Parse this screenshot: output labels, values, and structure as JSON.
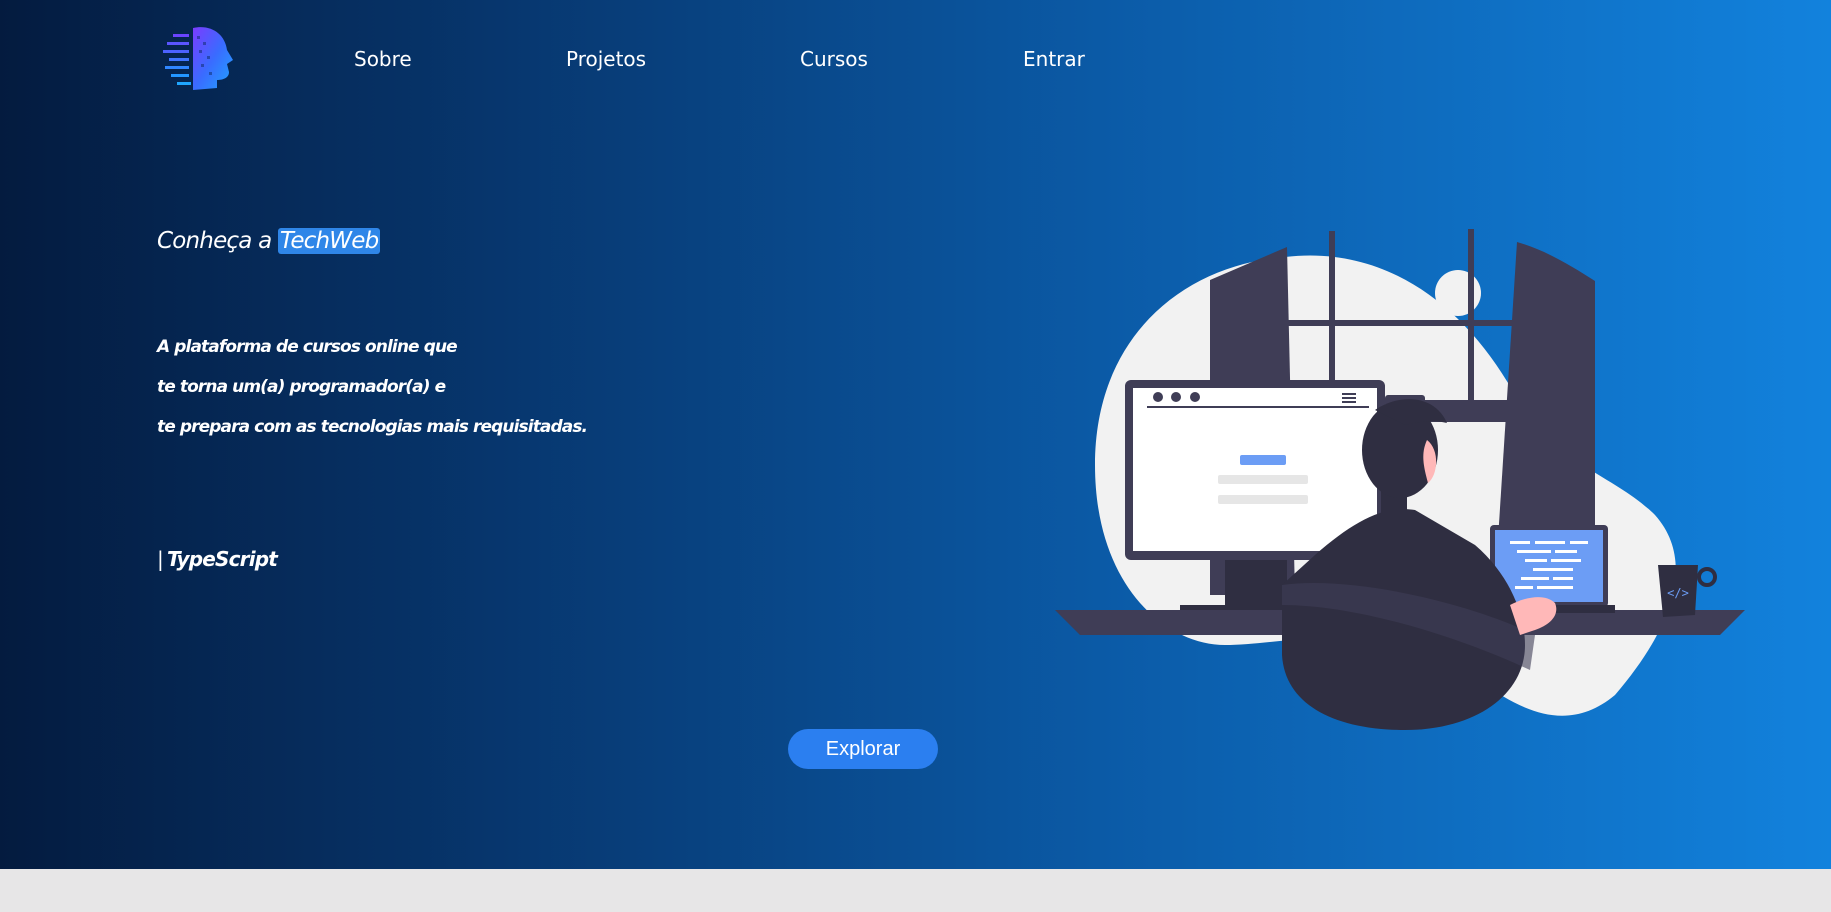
{
  "nav": {
    "logo_icon": "ai-head-logo",
    "links": [
      {
        "label": "Sobre"
      },
      {
        "label": "Projetos"
      },
      {
        "label": "Cursos"
      },
      {
        "label": "Entrar"
      }
    ]
  },
  "hero": {
    "headline_prefix": "Conheça a",
    "headline_highlight": "TechWeb",
    "description_lines": [
      "A plataforma de cursos online que",
      "te torna um(a) programador(a) e",
      "te prepara com as tecnologias mais requisitadas."
    ],
    "typed_cursor": "|",
    "typed_text": "TypeScript",
    "cta_label": "Explorar",
    "illustration_icon": "developer-at-desk-illustration"
  },
  "colors": {
    "gradient_start": "#041b3f",
    "gradient_end": "#1282dd",
    "highlight": "#2f86e8",
    "button": "#2b7ff0",
    "footer_strip": "#e7e6e7"
  }
}
